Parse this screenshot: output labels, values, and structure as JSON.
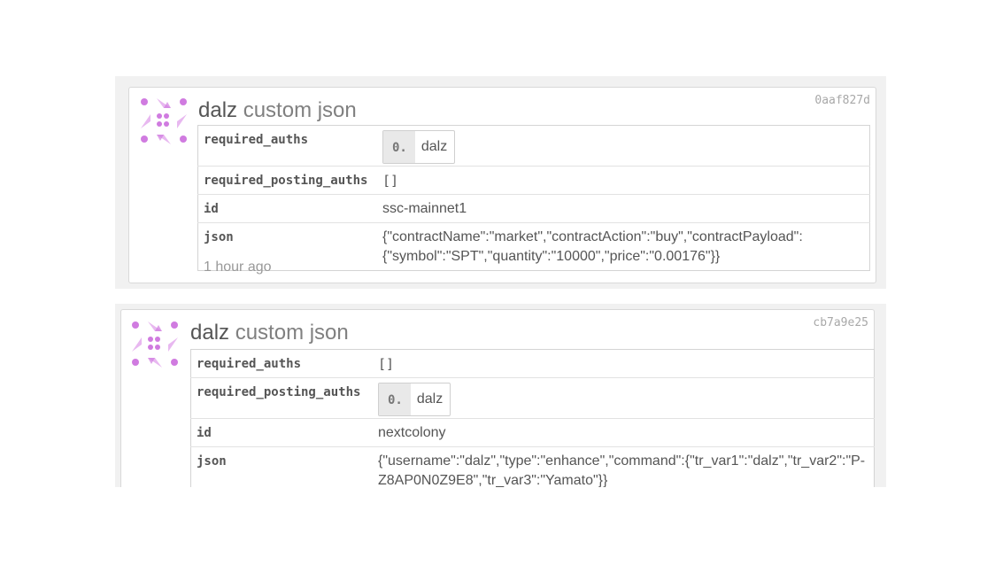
{
  "colors": {
    "avatar": "#d07be0",
    "avatar_light": "#e8b8f0"
  },
  "items": [
    {
      "txid": "0aaf827d",
      "author": "dalz",
      "op": "custom json",
      "fields": {
        "required_auths_label": "required_auths",
        "required_auths_idx": "0.",
        "required_auths_name": "dalz",
        "required_posting_auths_label": "required_posting_auths",
        "required_posting_auths_value": "[]",
        "id_label": "id",
        "id_value": "ssc-mainnet1",
        "json_label": "json",
        "json_value": "{\"contractName\":\"market\",\"contractAction\":\"buy\",\"contractPayload\": {\"symbol\":\"SPT\",\"quantity\":\"10000\",\"price\":\"0.00176\"}}"
      },
      "time_ago": "1 hour ago"
    },
    {
      "txid": "cb7a9e25",
      "author": "dalz",
      "op": "custom json",
      "fields": {
        "required_auths_label": "required_auths",
        "required_auths_value": "[]",
        "required_posting_auths_label": "required_posting_auths",
        "required_posting_auths_idx": "0.",
        "required_posting_auths_name": "dalz",
        "id_label": "id",
        "id_value": "nextcolony",
        "json_label": "json",
        "json_value": "{\"username\":\"dalz\",\"type\":\"enhance\",\"command\":{\"tr_var1\":\"dalz\",\"tr_var2\":\"P-Z8AP0N0Z9E8\",\"tr_var3\":\"Yamato\"}}"
      }
    }
  ]
}
